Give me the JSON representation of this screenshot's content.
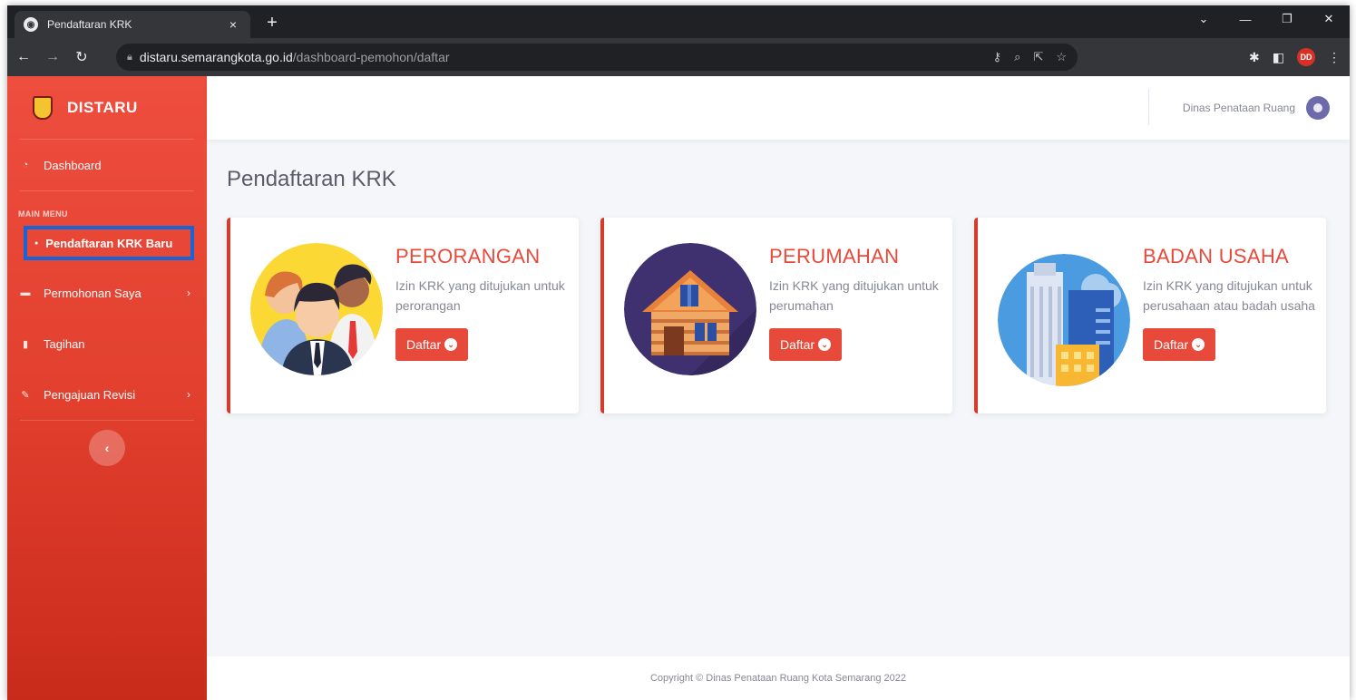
{
  "browser": {
    "tab_title": "Pendaftaran KRK",
    "tab_close": "×",
    "new_tab": "+",
    "url_host": "distaru.semarangkota.go.id",
    "url_path": "/dashboard-pemohon/daftar",
    "profile_initials": "DD"
  },
  "sidebar": {
    "brand": "DISTARU",
    "dashboard": "Dashboard",
    "menu_heading": "MAIN MENU",
    "active_item": "Pendaftaran KRK Baru",
    "items": [
      {
        "label": "Permohonan Saya",
        "has_chevron": true
      },
      {
        "label": "Tagihan",
        "has_chevron": false
      },
      {
        "label": "Pengajuan Revisi",
        "has_chevron": true
      }
    ],
    "collapse_symbol": "‹"
  },
  "topbar": {
    "user_name": "Dinas Penataan Ruang"
  },
  "page": {
    "title": "Pendaftaran KRK"
  },
  "cards": [
    {
      "title": "PERORANGAN",
      "description": "Izin KRK yang ditujukan untuk perorangan",
      "button": "Daftar"
    },
    {
      "title": "PERUMAHAN",
      "description": "Izin KRK yang ditujukan untuk perumahan",
      "button": "Daftar"
    },
    {
      "title": "BADAN USAHA",
      "description": "Izin KRK yang ditujukan untuk perusahaan atau badah usaha",
      "button": "Daftar"
    }
  ],
  "footer": {
    "copyright": "Copyright © Dinas Penataan Ruang Kota Semarang 2022"
  },
  "colors": {
    "accent": "#e74a3b",
    "sidebar": "#e3402f",
    "highlight_border": "#1565d8"
  }
}
